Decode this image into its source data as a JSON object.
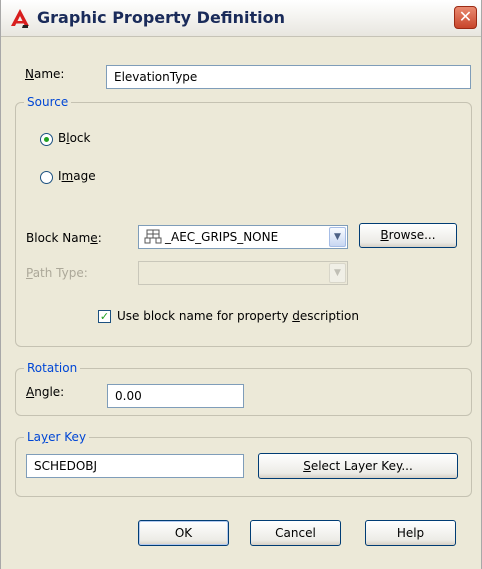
{
  "window": {
    "title": "Graphic Property Definition",
    "close_glyph": "✕",
    "icon": "autocad-icon"
  },
  "name": {
    "label_hot": "N",
    "label_rest": "ame:",
    "value": "ElevationType"
  },
  "source": {
    "legend": "Source",
    "block_radio": {
      "pre": "B",
      "hot": "l",
      "post": "ock",
      "selected": true
    },
    "image_radio": {
      "pre": "I",
      "hot": "m",
      "post": "age",
      "selected": false
    },
    "block_name": {
      "label_pre": "Block Nam",
      "label_hot": "e",
      "label_post": ":",
      "value": "_AEC_GRIPS_NONE",
      "icon": "block-icon"
    },
    "browse_button": {
      "hot": "B",
      "rest": "rowse..."
    },
    "path_type": {
      "label_hot": "P",
      "label_rest": "ath Type:",
      "value": ""
    },
    "use_block_name": {
      "pre": "Use block name for property ",
      "hot": "d",
      "post": "escription",
      "checked": true
    }
  },
  "rotation": {
    "legend": "Rotation",
    "angle_label_hot": "A",
    "angle_label_rest": "ngle:",
    "angle_value": "0.00"
  },
  "layer_key": {
    "legend_pre": "La",
    "legend_hot": "y",
    "legend_post": "er Key",
    "value": "SCHEDOBJ",
    "select_button": {
      "hot": "S",
      "rest": "elect Layer Key..."
    }
  },
  "footer": {
    "ok": "OK",
    "cancel": "Cancel",
    "help": "Help"
  },
  "colors": {
    "group_legend": "#0046d5",
    "dialog_bg": "#ece9d8",
    "close_red": "#c8452b",
    "radio_check_green": "#21a121"
  }
}
